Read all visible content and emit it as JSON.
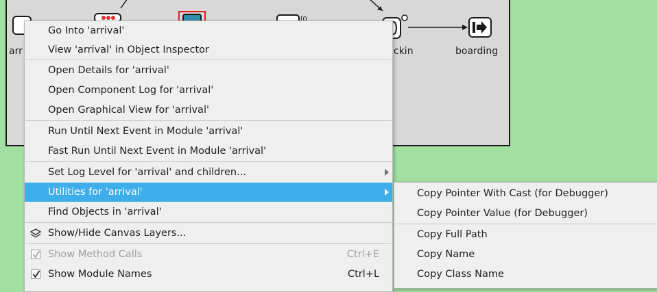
{
  "canvas": {
    "modules": [
      {
        "label": "arr"
      },
      {
        "label": "ckin"
      },
      {
        "label": "boarding"
      }
    ]
  },
  "context_menu": {
    "items": [
      {
        "label": "Go Into 'arrival'"
      },
      {
        "label": "View 'arrival' in Object Inspector"
      },
      {
        "label": "Open Details for 'arrival'"
      },
      {
        "label": "Open Component Log for 'arrival'"
      },
      {
        "label": "Open Graphical View for 'arrival'"
      },
      {
        "label": "Run Until Next Event in Module 'arrival'"
      },
      {
        "label": "Fast Run Until Next Event in Module 'arrival'"
      },
      {
        "label": "Set Log Level for 'arrival' and children..."
      },
      {
        "label": "Utilities for 'arrival'"
      },
      {
        "label": "Find Objects in 'arrival'"
      },
      {
        "label": "Show/Hide Canvas Layers..."
      },
      {
        "label": "Show Method Calls",
        "shortcut": "Ctrl+E",
        "checked": true,
        "enabled": false
      },
      {
        "label": "Show Module Names",
        "shortcut": "Ctrl+L",
        "checked": true,
        "enabled": true
      }
    ]
  },
  "utilities_submenu": {
    "items": [
      {
        "label": "Copy Pointer With Cast (for Debugger)"
      },
      {
        "label": "Copy Pointer Value (for Debugger)"
      },
      {
        "label": "Copy Full Path"
      },
      {
        "label": "Copy Name"
      },
      {
        "label": "Copy Class Name"
      }
    ]
  },
  "colors": {
    "background": "#a1e0a1",
    "canvas": "#d8d8d8",
    "menu": "#efefef",
    "highlight": "#3daee9"
  }
}
